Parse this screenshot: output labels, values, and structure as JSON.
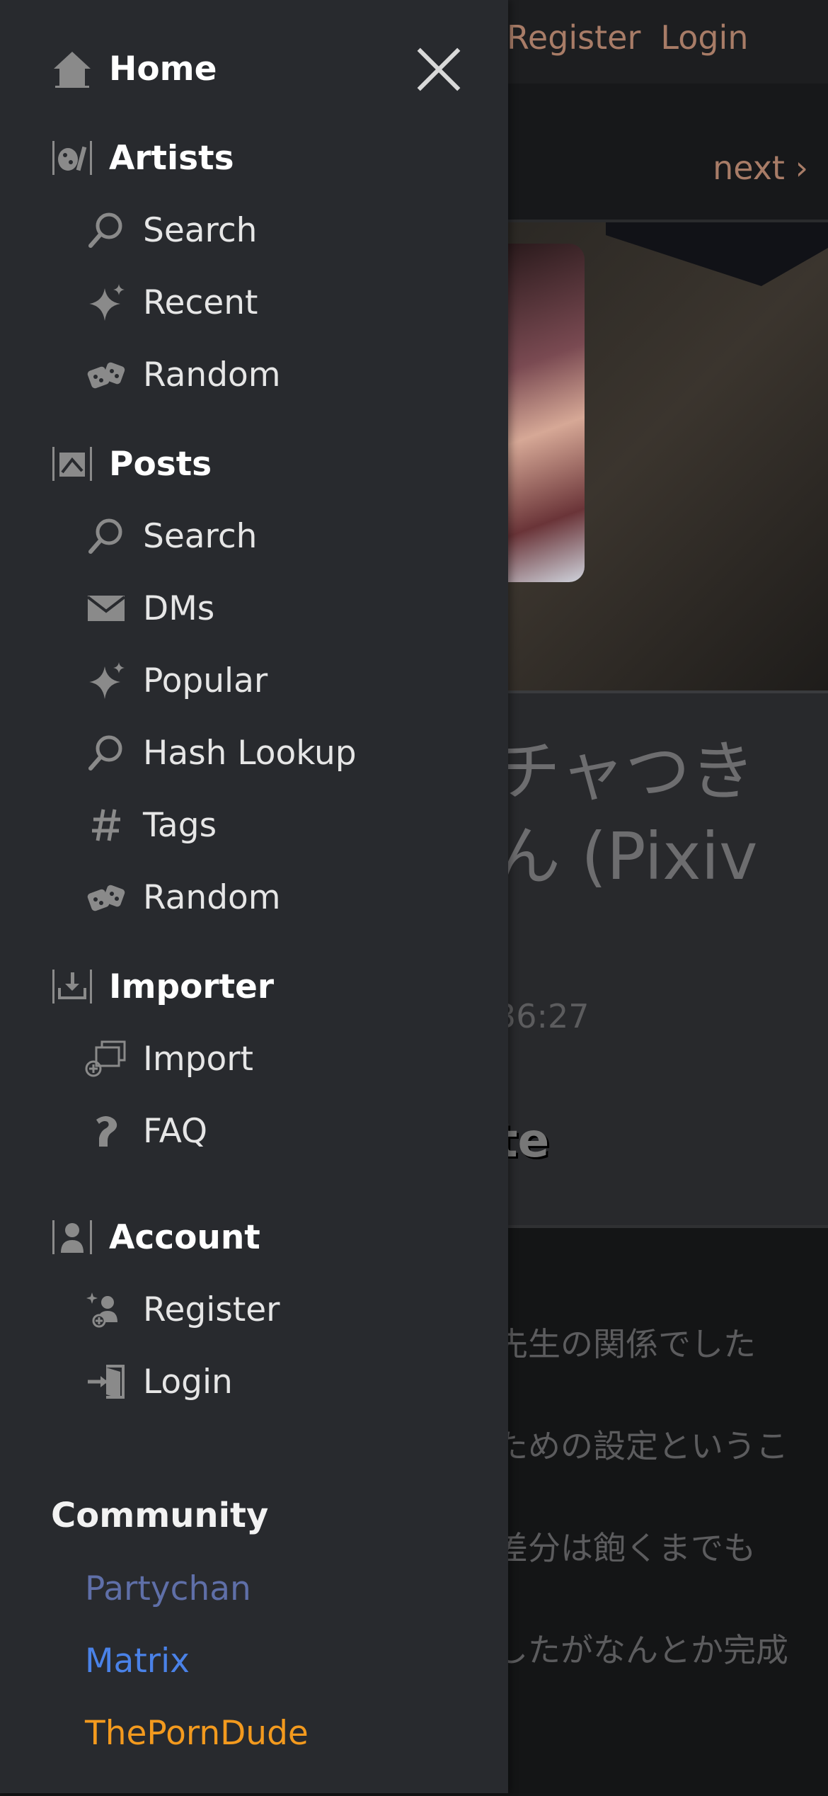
{
  "background": {
    "topbar": {
      "register": "Register",
      "login": "Login"
    },
    "pager": {
      "next": "next ›"
    },
    "title_fragment": "チャつき\nん (Pixiv",
    "date_fragment": "36:27",
    "note_fragment": "te",
    "content_lines": [
      "先生の関係でした",
      "ための設定というこ",
      "差分は飽くまでも",
      "したがなんとか完成"
    ]
  },
  "nav": {
    "home": "Home",
    "artists": {
      "label": "Artists",
      "items": [
        {
          "label": "Search",
          "icon": "search-icon"
        },
        {
          "label": "Recent",
          "icon": "sparkle-icon"
        },
        {
          "label": "Random",
          "icon": "dice-icon"
        }
      ]
    },
    "posts": {
      "label": "Posts",
      "items": [
        {
          "label": "Search",
          "icon": "search-icon"
        },
        {
          "label": "DMs",
          "icon": "envelope-icon"
        },
        {
          "label": "Popular",
          "icon": "sparkle-icon"
        },
        {
          "label": "Hash Lookup",
          "icon": "search-icon"
        },
        {
          "label": "Tags",
          "icon": "hash-icon"
        },
        {
          "label": "Random",
          "icon": "dice-icon"
        }
      ]
    },
    "importer": {
      "label": "Importer",
      "items": [
        {
          "label": "Import",
          "icon": "import-icon"
        },
        {
          "label": "FAQ",
          "icon": "faq-icon"
        }
      ]
    },
    "account": {
      "label": "Account",
      "items": [
        {
          "label": "Register",
          "icon": "register-icon"
        },
        {
          "label": "Login",
          "icon": "login-icon"
        }
      ]
    },
    "community": {
      "label": "Community",
      "links": [
        {
          "label": "Partychan",
          "color": "#5f6fa8"
        },
        {
          "label": "Matrix",
          "color": "#4a82e8"
        },
        {
          "label": "ThePornDude",
          "color": "#f39a1e"
        }
      ]
    }
  }
}
